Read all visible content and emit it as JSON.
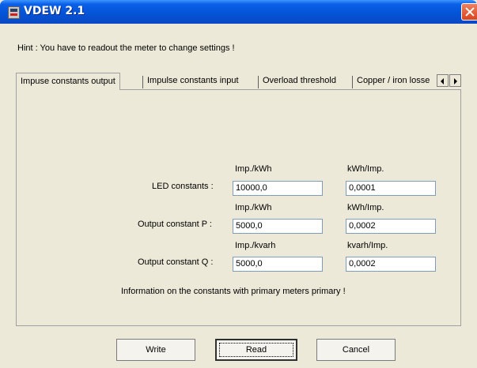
{
  "window": {
    "title": "VDEW 2.1"
  },
  "hint": "Hint : You have to readout the meter to change settings !",
  "tabs": [
    "Impuse constants output",
    "Impulse constants input",
    "Overload threshold",
    "Copper / iron losse"
  ],
  "rows": [
    {
      "label": "LED constants :",
      "unit_left": "Imp./kWh",
      "value_left": "10000,0",
      "unit_right": "kWh/Imp.",
      "value_right": "0,0001"
    },
    {
      "label": "Output constant P :",
      "unit_left": "Imp./kWh",
      "value_left": "5000,0",
      "unit_right": "kWh/Imp.",
      "value_right": "0,0002"
    },
    {
      "label": "Output constant Q :",
      "unit_left": "Imp./kvarh",
      "value_left": "5000,0",
      "unit_right": "kvarh/Imp.",
      "value_right": "0,0002"
    }
  ],
  "info": "Information on the constants with primary meters primary !",
  "buttons": {
    "write": "Write",
    "read": "Read",
    "cancel": "Cancel"
  },
  "icons": {
    "app": "vdew-app-icon",
    "close": "close-icon",
    "scroll_left": "arrow-left-icon",
    "scroll_right": "arrow-right-icon"
  },
  "colors": {
    "titlebar": "#0454d8",
    "close": "#d8441c",
    "window_bg": "#ece9d8"
  }
}
